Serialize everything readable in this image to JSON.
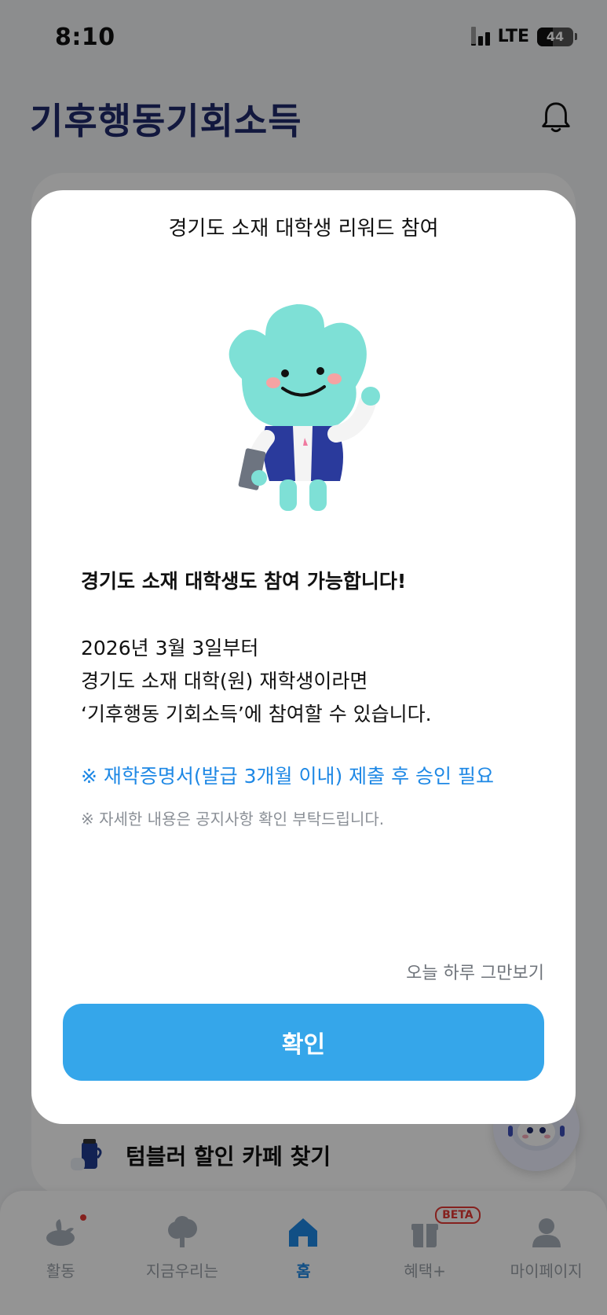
{
  "status_bar": {
    "time": "8:10",
    "network": "LTE",
    "battery": "44",
    "battery_level": 0.44
  },
  "header": {
    "logo_text": "기후행동기회소득"
  },
  "home": {
    "tumbler_label": "텀블러 할인 카페 찾기"
  },
  "nav": {
    "items": [
      {
        "label": "활동"
      },
      {
        "label": "지금우리는"
      },
      {
        "label": "홈"
      },
      {
        "label": "혜택+",
        "badge": "BETA"
      },
      {
        "label": "마이페이지"
      }
    ]
  },
  "modal": {
    "title": "경기도 소재 대학생 리워드 참여",
    "headline": "경기도 소재 대학생도 참여 가능합니다!",
    "desc_line1": "2026년 3월 3일부터",
    "desc_line2": "경기도 소재 대학(원) 재학생이라면",
    "desc_line3": "‘기후행동 기회소득’에 참여할 수 있습니다.",
    "notice_blue": "※ 재학증명서(발급 3개월 이내) 제출 후 승인 필요",
    "notice_gray": "※  자세한 내용은 공지사항 확인 부탁드립니다.",
    "dismiss_label": "오늘 하루 그만보기",
    "confirm_label": "확인"
  },
  "colors": {
    "accent": "#35a6ea",
    "notice": "#1e88e5",
    "brand": "#1f2a6b",
    "mascot": "#7ee0d6"
  }
}
